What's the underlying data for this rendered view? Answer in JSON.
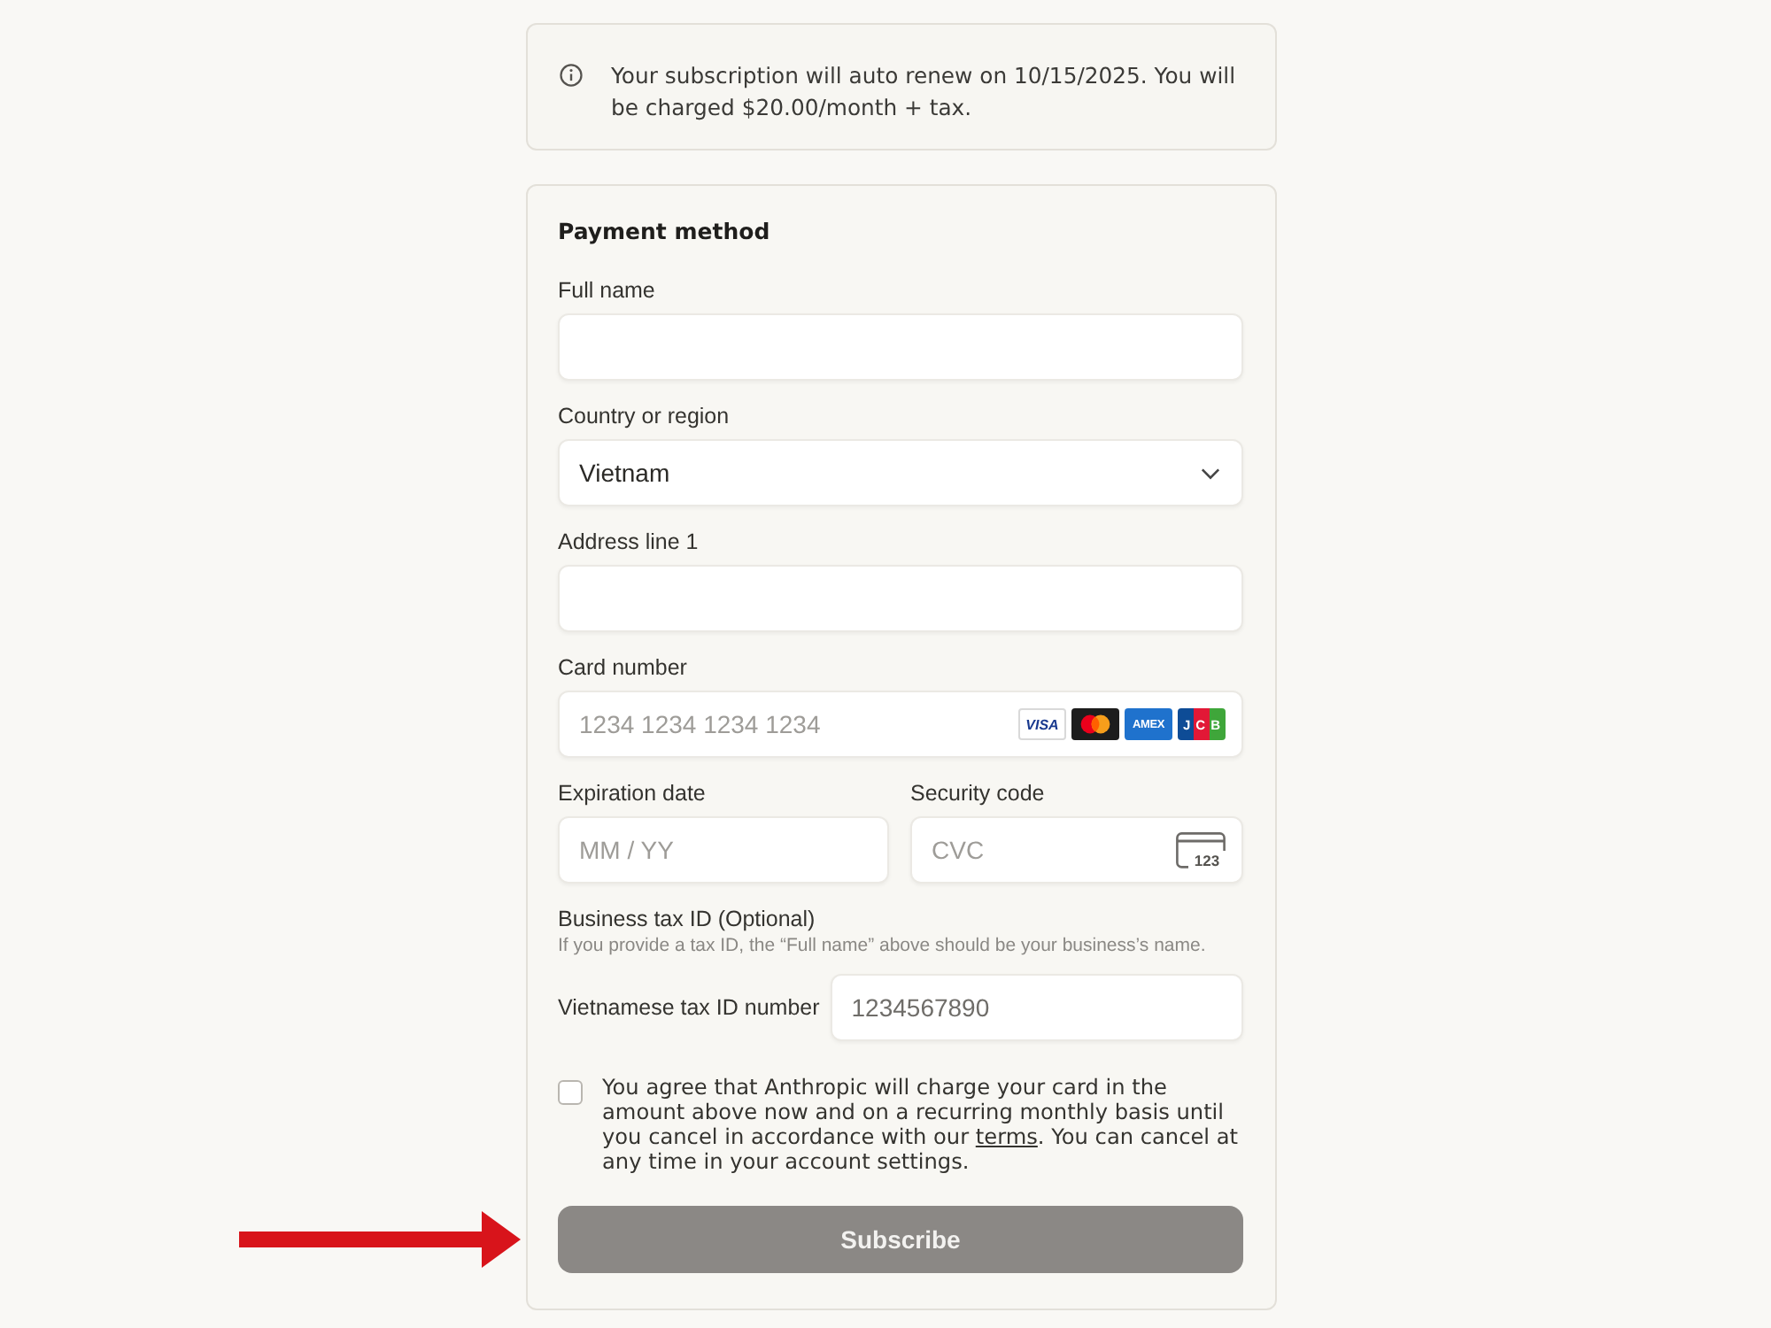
{
  "notice": {
    "text": "Your subscription will auto renew on 10/15/2025. You will be charged $20.00/month + tax."
  },
  "payment_method": {
    "title": "Payment method",
    "fields": [
      {
        "kind": "text",
        "label": "Full name"
      },
      {
        "kind": "select",
        "label": "Country or region",
        "value": "Vietnam"
      },
      {
        "kind": "text",
        "label": "Address line 1"
      },
      {
        "kind": "card",
        "label": "Card number",
        "placeholder": "1234 1234 1234 1234",
        "brands": [
          {
            "kind": "visa",
            "label": "VISA"
          },
          {
            "kind": "mastercard"
          },
          {
            "kind": "amex",
            "label": "AMEX"
          },
          {
            "kind": "jcb",
            "label": "JCB"
          }
        ]
      }
    ],
    "expiration_date": {
      "label": "Expiration date",
      "placeholder": "MM / YY"
    },
    "security_code": {
      "label": "Security code",
      "placeholder": "CVC",
      "icon_text": "123"
    },
    "business_tax_id": {
      "label": "Business tax ID (Optional)",
      "hint": "If you provide a tax ID, the “Full name” above should be your business’s name.",
      "id_label": "Vietnamese tax ID number",
      "placeholder": "1234567890"
    },
    "agreement": {
      "checked": false,
      "text_before": "You agree that Anthropic will charge your card in the amount above now and on a recurring monthly basis until you cancel in accordance with our ",
      "link": "terms",
      "text_after": ". You can cancel at any time in your account settings."
    },
    "subscribe_button": {
      "label": "Subscribe",
      "disabled": true
    }
  }
}
